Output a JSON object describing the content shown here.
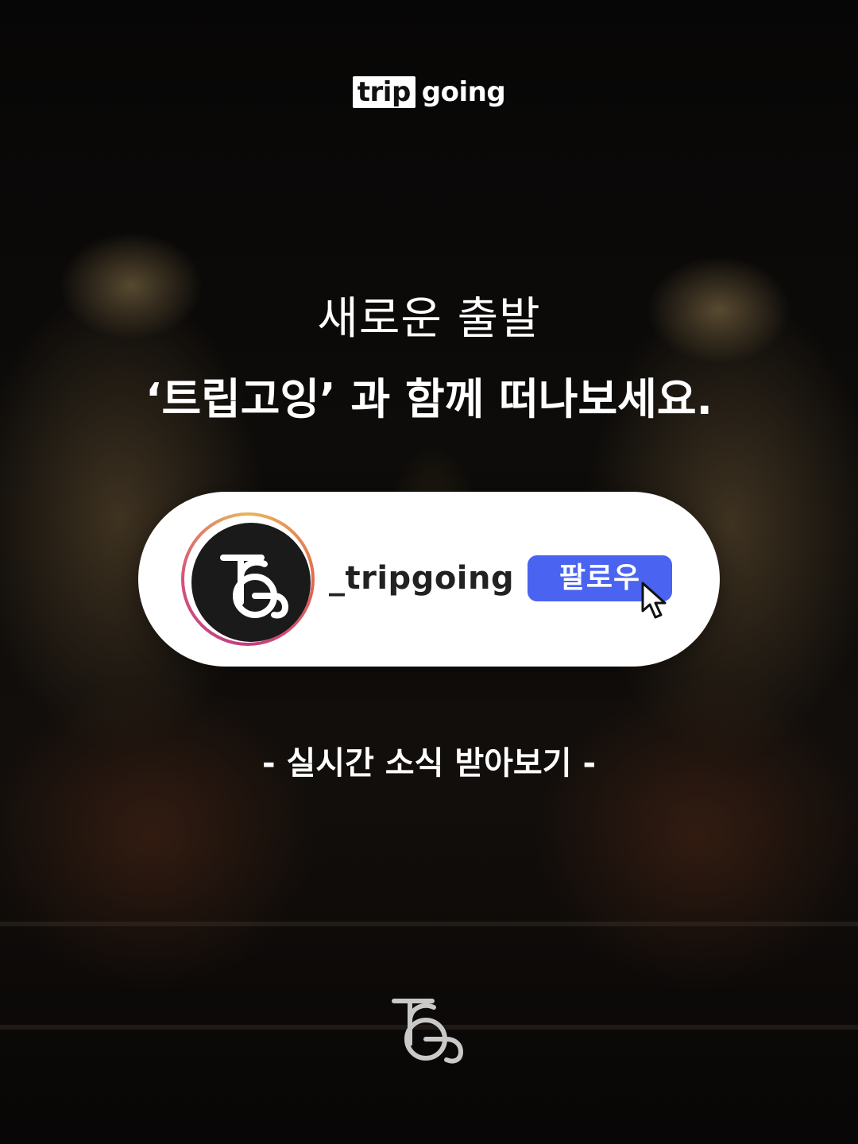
{
  "brand": {
    "word_boxed": "trip",
    "word_plain": "going"
  },
  "headline": {
    "line1": "새로운 출발",
    "line2": "‘트립고잉’ 과 함께 떠나보세요."
  },
  "profile_card": {
    "avatar_icon": "tg-monogram-logo",
    "username": "_tripgoing",
    "follow_label": "팔로우",
    "follow_color": "#4a63f0",
    "cursor_icon": "pointer-cursor-icon"
  },
  "tagline": "- 실시간 소식 받아보기 -",
  "footer": {
    "logo_icon": "tg-monogram-logo"
  }
}
